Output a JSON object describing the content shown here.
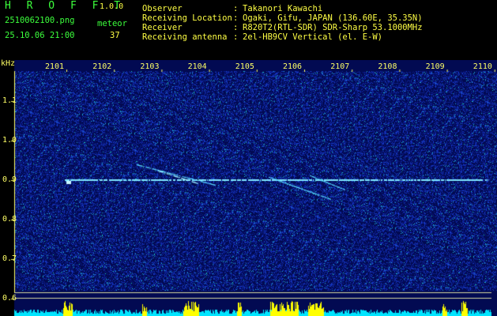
{
  "app": {
    "name": "H R O F F T",
    "version": "1.0.0"
  },
  "file": {
    "name": "2510062100.png",
    "datetime": "25.10.06 21:00"
  },
  "counter": {
    "label": "meteor",
    "value": "37"
  },
  "info": [
    {
      "label": "Observer",
      "sep": ":",
      "value": "Takanori Kawachi"
    },
    {
      "label": "Receiving Location",
      "sep": ":",
      "value": "Ogaki, Gifu, JAPAN (136.60E, 35.35N)"
    },
    {
      "label": "Receiver",
      "sep": ":",
      "value": "R820T2(RTL-SDR) SDR-Sharp 53.1000MHz"
    },
    {
      "label": "Receiving antenna",
      "sep": ":",
      "value": "2el-HB9CV Vertical (el. E-W)"
    }
  ],
  "axes": {
    "y_unit": "kHz",
    "time_ticks": [
      "2101",
      "2102",
      "2103",
      "2104",
      "2105",
      "2106",
      "2107",
      "2108",
      "2109",
      "2110"
    ],
    "freq_ticks": [
      "1.1",
      "1.0",
      "0.9",
      "0.8",
      "0.7",
      "0.6"
    ]
  },
  "colors": {
    "header_green": "#3cff3c",
    "header_yellow": "#ffff44",
    "axis_yellow": "#ffff66",
    "background": "#000000",
    "noise_blue": "#0a1a8c",
    "carrier": "#7fe6ff",
    "activity_bar": "#ffff00",
    "baseline_cyan": "#00e5ff"
  }
}
